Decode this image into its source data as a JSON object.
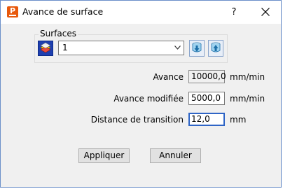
{
  "window": {
    "title": "Avance de surface",
    "app_icon_letter": "P",
    "help_glyph": "?"
  },
  "surfaces": {
    "group_label": "Surfaces",
    "selected_value": "1"
  },
  "fields": {
    "avance": {
      "label": "Avance",
      "value": "10000,0",
      "unit": "mm/min"
    },
    "avance_modifiee": {
      "label": "Avance modifiée",
      "value": "5000,0",
      "unit": "mm/min"
    },
    "distance_transition": {
      "label": "Distance de transition",
      "value": "12,0",
      "unit": "mm"
    }
  },
  "buttons": {
    "apply": "Appliquer",
    "cancel": "Annuler"
  }
}
